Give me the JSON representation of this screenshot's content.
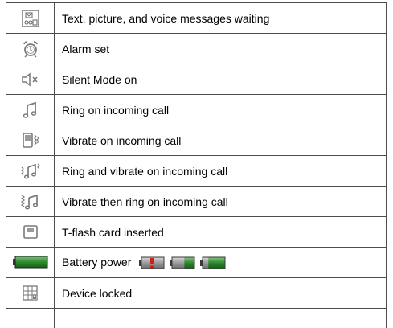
{
  "rows": [
    {
      "icon": "messages-waiting-icon",
      "label": "Text, picture, and voice messages waiting"
    },
    {
      "icon": "alarm-clock-icon",
      "label": "Alarm set"
    },
    {
      "icon": "silent-mode-icon",
      "label": "Silent Mode on"
    },
    {
      "icon": "ring-icon",
      "label": "Ring on incoming call"
    },
    {
      "icon": "vibrate-icon",
      "label": "Vibrate on incoming call"
    },
    {
      "icon": "ring-and-vibrate-icon",
      "label": "Ring and vibrate on incoming call"
    },
    {
      "icon": "vibrate-then-ring-icon",
      "label": "Vibrate then ring on incoming call"
    },
    {
      "icon": "tflash-card-icon",
      "label": "T-flash card inserted"
    },
    {
      "icon": "battery-full-icon",
      "label": "Battery power"
    },
    {
      "icon": "device-locked-icon",
      "label": "Device locked"
    }
  ],
  "battery_levels": [
    {
      "icon": "battery-empty-icon",
      "level": 0
    },
    {
      "icon": "battery-medium-icon",
      "level": 0.45
    },
    {
      "icon": "battery-high-icon",
      "level": 0.75
    }
  ],
  "colors": {
    "border": "#4d4d4d",
    "icon_gray": "#7a7a7a",
    "battery_green": "#2e8b2e",
    "battery_warning": "#d0201a"
  }
}
